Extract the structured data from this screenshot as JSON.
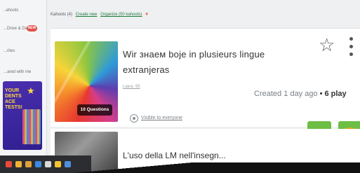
{
  "sidebar": {
    "items": [
      {
        "label": "..ahoots"
      },
      {
        "label": "...Drive & Datro"
      },
      {
        "label": "...rites"
      },
      {
        "label": "...ared with me"
      }
    ],
    "new_badge": "NEW",
    "promo": {
      "text": "YOUR DENTS ACE TESTS!"
    }
  },
  "header": {
    "kahoots_count": "Kahoots (4)",
    "create_link": "Create new",
    "organize_link": "Organize (50 kahoots)"
  },
  "cards": [
    {
      "thumbnail_badge": "10 Questions",
      "title": "Wir знаем boje in plusieurs lingue extranjeras",
      "author": "Liana_95",
      "created": "Created 1 day ago",
      "plays": "• 6 play",
      "visibility": "Visible to everyone",
      "actions": [
        {
          "name": "play-icon",
          "glyph": "▷"
        },
        {
          "name": "trophy-icon",
          "glyph": "🏆"
        }
      ]
    },
    {
      "title": "L'uso della LM nell'insegn..."
    }
  ],
  "colors": {
    "accent_green": "#6cbe45",
    "link_green": "#1f7a3a",
    "badge_red": "#e2504b"
  }
}
